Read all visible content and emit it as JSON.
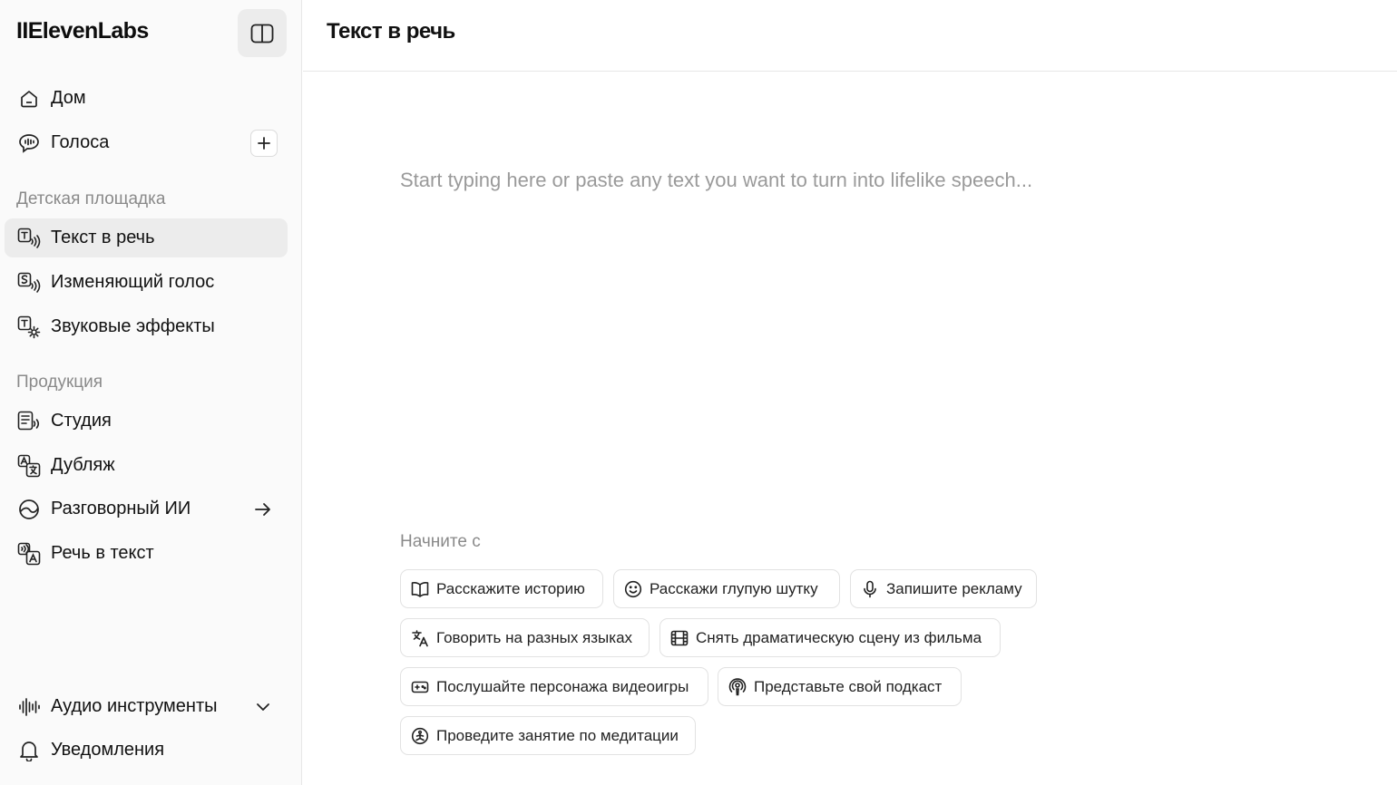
{
  "app": {
    "logo": "IIElevenLabs"
  },
  "sidebar": {
    "top_items": [
      {
        "label": "Дом",
        "icon": "home-icon"
      },
      {
        "label": "Голоса",
        "icon": "voices-icon"
      }
    ],
    "sections": [
      {
        "title": "Детская площадка",
        "items": [
          {
            "label": "Текст в речь",
            "icon": "text-to-speech-icon",
            "active": true
          },
          {
            "label": "Изменяющий голос",
            "icon": "voice-changer-icon"
          },
          {
            "label": "Звуковые эффекты",
            "icon": "sound-effects-icon"
          }
        ]
      },
      {
        "title": "Продукция",
        "items": [
          {
            "label": "Студия",
            "icon": "studio-icon"
          },
          {
            "label": "Дубляж",
            "icon": "dubbing-icon"
          },
          {
            "label": "Разговорный ИИ",
            "icon": "conversational-ai-icon"
          },
          {
            "label": "Речь в текст",
            "icon": "speech-to-text-icon"
          }
        ]
      }
    ],
    "bottom_items": [
      {
        "label": "Аудио инструменты",
        "icon": "audio-tools-icon"
      },
      {
        "label": "Уведомления",
        "icon": "bell-icon"
      }
    ]
  },
  "header": {
    "title": "Текст в речь"
  },
  "editor": {
    "placeholder": "Start typing here or paste any text you want to turn into lifelike speech...",
    "value": ""
  },
  "suggestions": {
    "label": "Начните с",
    "chips": [
      {
        "label": "Расскажите историю",
        "icon": "book-icon"
      },
      {
        "label": "Расскажи глупую шутку",
        "icon": "smiley-icon"
      },
      {
        "label": "Запишите рекламу",
        "icon": "microphone-icon"
      },
      {
        "label": "Говорить на разных языках",
        "icon": "translate-icon"
      },
      {
        "label": "Снять драматическую сцену из фильма",
        "icon": "film-icon"
      },
      {
        "label": "Послушайте персонажа видеоигры",
        "icon": "gamepad-icon"
      },
      {
        "label": "Представьте свой подкаст",
        "icon": "podcast-icon"
      },
      {
        "label": "Проведите занятие по медитации",
        "icon": "meditation-icon"
      }
    ]
  }
}
